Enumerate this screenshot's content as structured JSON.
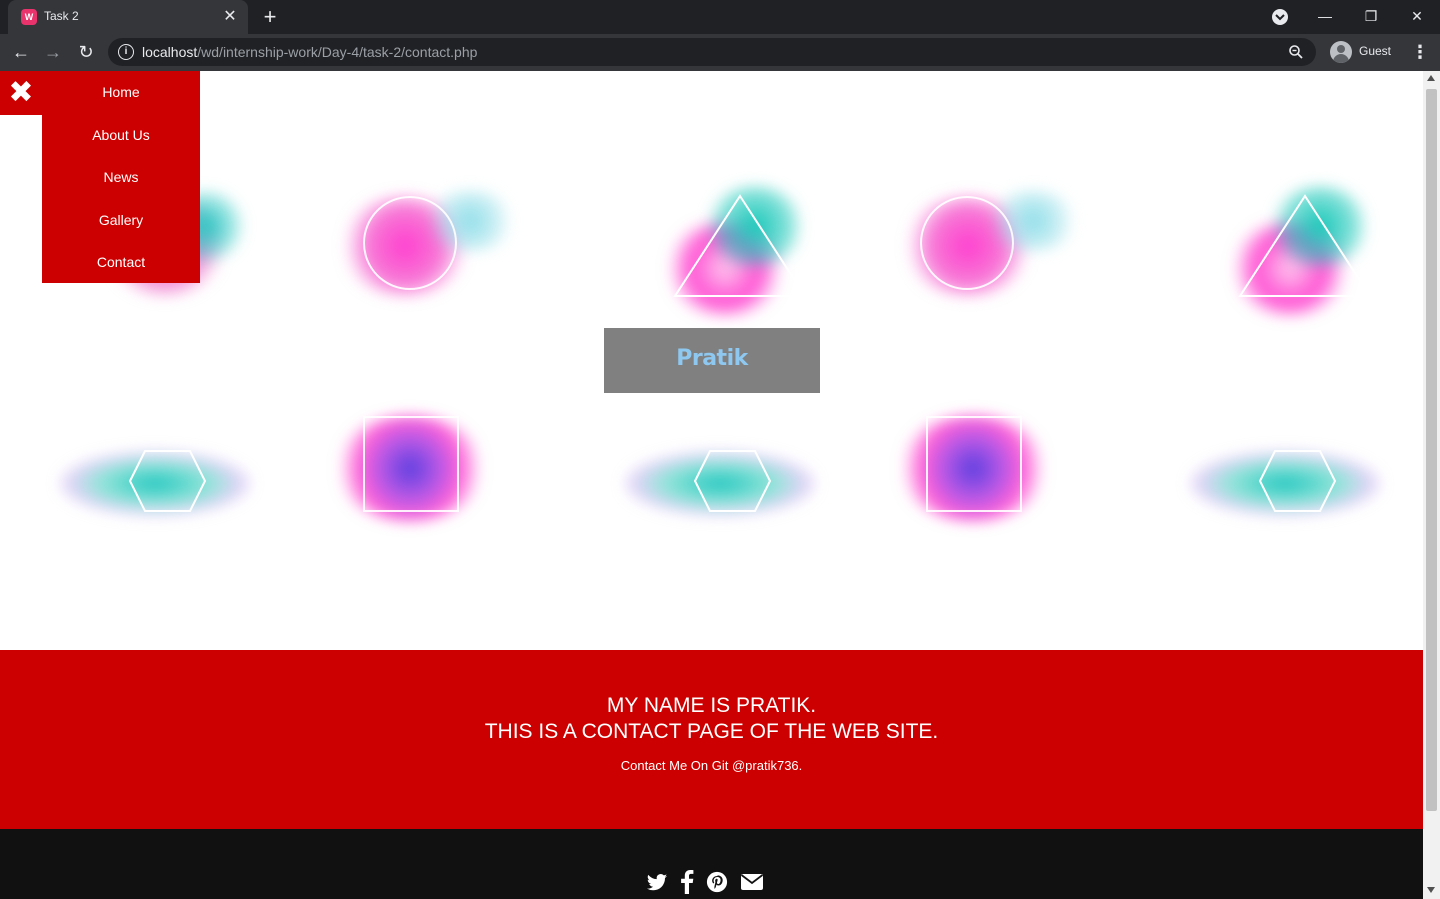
{
  "browser": {
    "tab_title": "Task 2",
    "tab_favicon_text": "W",
    "url_host": "localhost",
    "url_path": "/wd/internship-work/Day-4/task-2/contact.php",
    "profile_label": "Guest"
  },
  "menu": {
    "close_icon": "close-icon",
    "items": [
      "Home",
      "About Us",
      "News",
      "Gallery",
      "Contact"
    ]
  },
  "logo": {
    "text": "Pratik"
  },
  "footer": {
    "line1": "MY NAME IS PRATIK.",
    "line2": "THIS IS A CONTACT PAGE OF THE WEB SITE.",
    "line3": "Contact Me On Git @pratik736.",
    "social_icons": [
      "twitter-icon",
      "facebook-icon",
      "pinterest-icon",
      "envelope-icon"
    ]
  },
  "colors": {
    "accent_red": "#cc0000",
    "dark_footer": "#111111",
    "logo_box": "#808080",
    "logo_text": "#8ec8f0"
  }
}
